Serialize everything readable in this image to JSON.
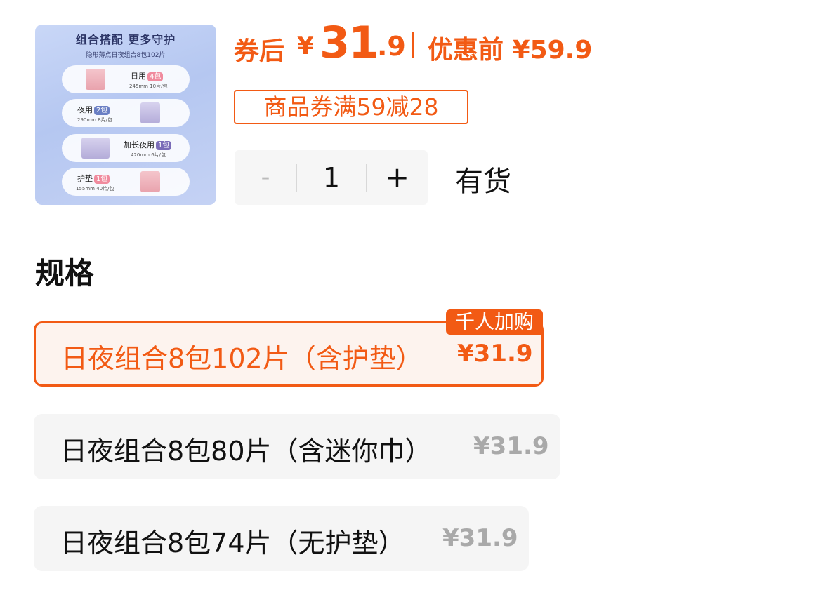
{
  "product_image": {
    "title": "组合搭配 更多守护",
    "subtitle": "隐形薄点日夜组合8包102片",
    "items": [
      {
        "name": "日用",
        "tag": "4包",
        "spec": "245mm 10片/包"
      },
      {
        "name": "夜用",
        "tag": "2包",
        "spec": "290mm 8片/包"
      },
      {
        "name": "加长夜用",
        "tag": "1包",
        "spec": "420mm 6片/包"
      },
      {
        "name": "护垫",
        "tag": "1包",
        "spec": "155mm 40片/包"
      }
    ]
  },
  "price": {
    "after_coupon_label": "券后",
    "currency": "¥",
    "integer": "31",
    "decimal": ".9",
    "original_label": "优惠前 ¥59.9",
    "accent_color": "#f25a14"
  },
  "coupon": {
    "label": "商品券满59减28"
  },
  "quantity": {
    "minus": "-",
    "value": "1",
    "plus": "+"
  },
  "stock": {
    "label": "有货"
  },
  "specs": {
    "title": "规格",
    "badge": "千人加购",
    "options": [
      {
        "name": "日夜组合8包102片（含护垫）",
        "price": "¥31.9",
        "selected": true
      },
      {
        "name": "日夜组合8包80片（含迷你巾）",
        "price": "¥31.9",
        "selected": false
      },
      {
        "name": "日夜组合8包74片（无护垫）",
        "price": "¥31.9",
        "selected": false
      }
    ]
  }
}
